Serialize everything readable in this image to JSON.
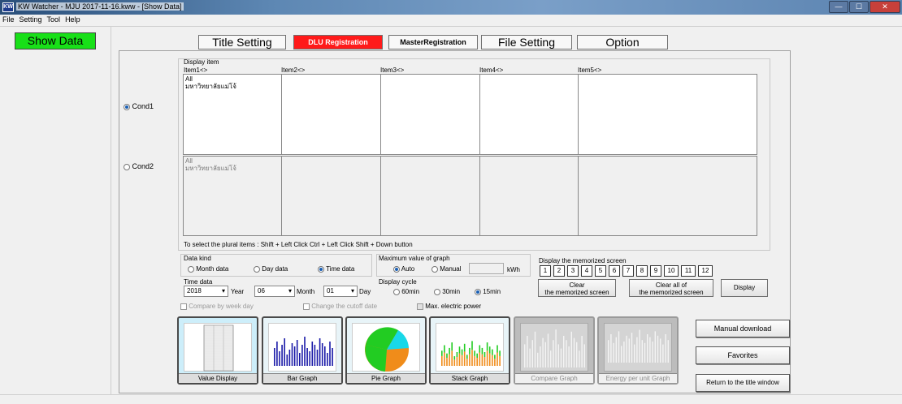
{
  "window": {
    "title": "KW Watcher - MJU 2017-11-16.kww - [Show Data]",
    "app_icon": "KW",
    "controls": {
      "minimize": "—",
      "maximize": "☐",
      "close": "✕"
    }
  },
  "menu": [
    "File",
    "Setting",
    "Tool",
    "Help"
  ],
  "tabs": {
    "show_data": "Show Data",
    "title_setting": "Title Setting",
    "dlu_registration": "DLU Registration",
    "master_registration": "MasterRegistration",
    "file_setting": "File Setting",
    "option": "Option"
  },
  "display_item": {
    "label": "Display item",
    "columns": [
      "Item1<>",
      "Item2<>",
      "Item3<>",
      "Item4<>",
      "Item5<>"
    ],
    "cond1": {
      "label": "Cond1",
      "selected": true,
      "values": [
        "All",
        "มหาวิทยาลัยแม่โจ้"
      ]
    },
    "cond2": {
      "label": "Cond2",
      "selected": false,
      "values": [
        "All",
        "มหาวิทยาลัยแม่โจ้"
      ]
    },
    "hint": "To select the plural items : Shift + Left Click  Ctrl + Left Click  Shift + Down button"
  },
  "data_kind": {
    "label": "Data kind",
    "options": [
      "Month data",
      "Day data",
      "Time data"
    ],
    "selected": "Time data"
  },
  "time_data": {
    "label": "Time data",
    "year": "2018",
    "year_label": "Year",
    "month": "06",
    "month_label": "Month",
    "day": "01",
    "day_label": "Day",
    "dropdown_icon": "▾"
  },
  "options_checks": {
    "compare_by_week_day": "Compare by week day",
    "change_cutoff": "Change the cutoff date",
    "max_power": "Max. electric power"
  },
  "max_value": {
    "label": "Maximum value of graph",
    "options": [
      "Auto",
      "Manual"
    ],
    "selected": "Auto",
    "manual_value": "",
    "unit": "kWh"
  },
  "display_cycle": {
    "label": "Display cycle",
    "options": [
      "60min",
      "30min",
      "15min"
    ],
    "selected": "15min"
  },
  "memorized": {
    "label": "Display the memorized screen",
    "numbers": [
      "1",
      "2",
      "3",
      "4",
      "5",
      "6",
      "7",
      "8",
      "9",
      "10",
      "11",
      "12"
    ],
    "clear_line1": "Clear",
    "clear_line2": "the memorized screen",
    "clear_all_line1": "Clear all of",
    "clear_all_line2": "the memorized screen",
    "display": "Display"
  },
  "graphs": [
    {
      "label": "Value Display",
      "icon": "table-icon",
      "enabled": true
    },
    {
      "label": "Bar Graph",
      "icon": "bar-graph-icon",
      "enabled": true
    },
    {
      "label": "Pie Graph",
      "icon": "pie-graph-icon",
      "enabled": true
    },
    {
      "label": "Stack Graph",
      "icon": "stack-graph-icon",
      "enabled": true
    },
    {
      "label": "Compare Graph",
      "icon": "compare-graph-icon",
      "enabled": false
    },
    {
      "label": "Energy per unit Graph",
      "icon": "energy-graph-icon",
      "enabled": false
    }
  ],
  "right_buttons": {
    "manual_download": "Manual download",
    "favorites": "Favorites",
    "return": "Return to the title window"
  },
  "colors": {
    "show_data_bg": "#18e018",
    "dlu_bg": "#ff1a1a",
    "bar": "#1a1aa8",
    "pie_green": "#22cc22",
    "pie_orange": "#f08c1a",
    "pie_cyan": "#18d8e8"
  }
}
